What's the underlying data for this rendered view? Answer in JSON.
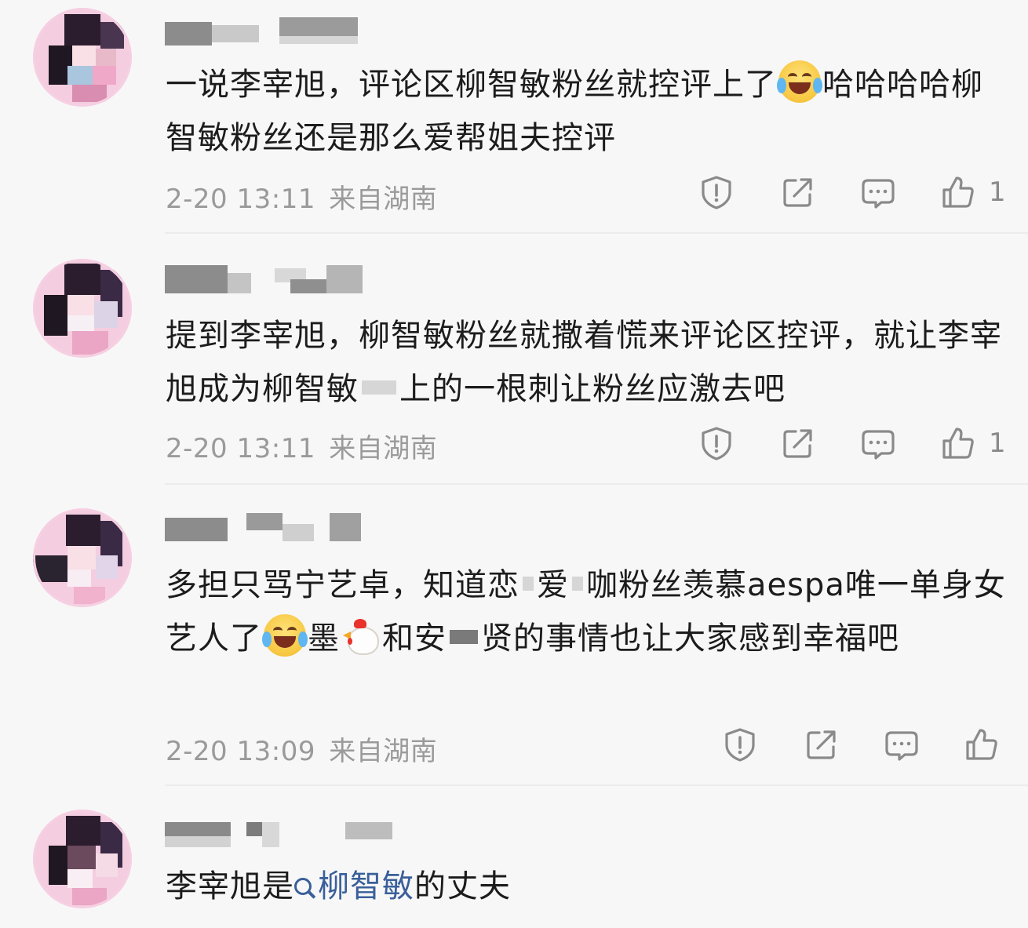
{
  "comments": [
    {
      "text_parts": [
        "一说李宰旭，评论区柳智敏粉丝就控评上了",
        "哈哈哈哈柳智敏粉丝还是那么爱帮姐夫控评"
      ],
      "time": "2-20 13:11",
      "location": "来自湖南",
      "likes": "1"
    },
    {
      "text_parts": [
        "提到李宰旭，柳智敏粉丝就撒着慌来评论区控评，就让李宰旭成为柳智敏",
        "上的一根刺让粉丝应激去吧"
      ],
      "time": "2-20 13:11",
      "location": "来自湖南",
      "likes": "1"
    },
    {
      "text_parts": [
        "多担只骂宁艺卓，知道恋",
        "爱",
        "咖粉丝羡慕aespa唯一单身女艺人了",
        "墨",
        "和安",
        "贤的事情也让大家感到幸福吧"
      ],
      "time": "2-20 13:09",
      "location": "来自湖南",
      "likes": ""
    },
    {
      "text_parts": [
        "李宰旭是",
        "柳智敏",
        "的丈夫"
      ]
    }
  ],
  "icons": {
    "report": "report-icon",
    "share": "share-icon",
    "comment": "comment-icon",
    "like": "like-icon",
    "search": "search-icon"
  },
  "colors": {
    "background": "#f7f7f7",
    "text": "#1c1c1c",
    "meta": "#9a9a9a",
    "link": "#3a5f9a"
  }
}
